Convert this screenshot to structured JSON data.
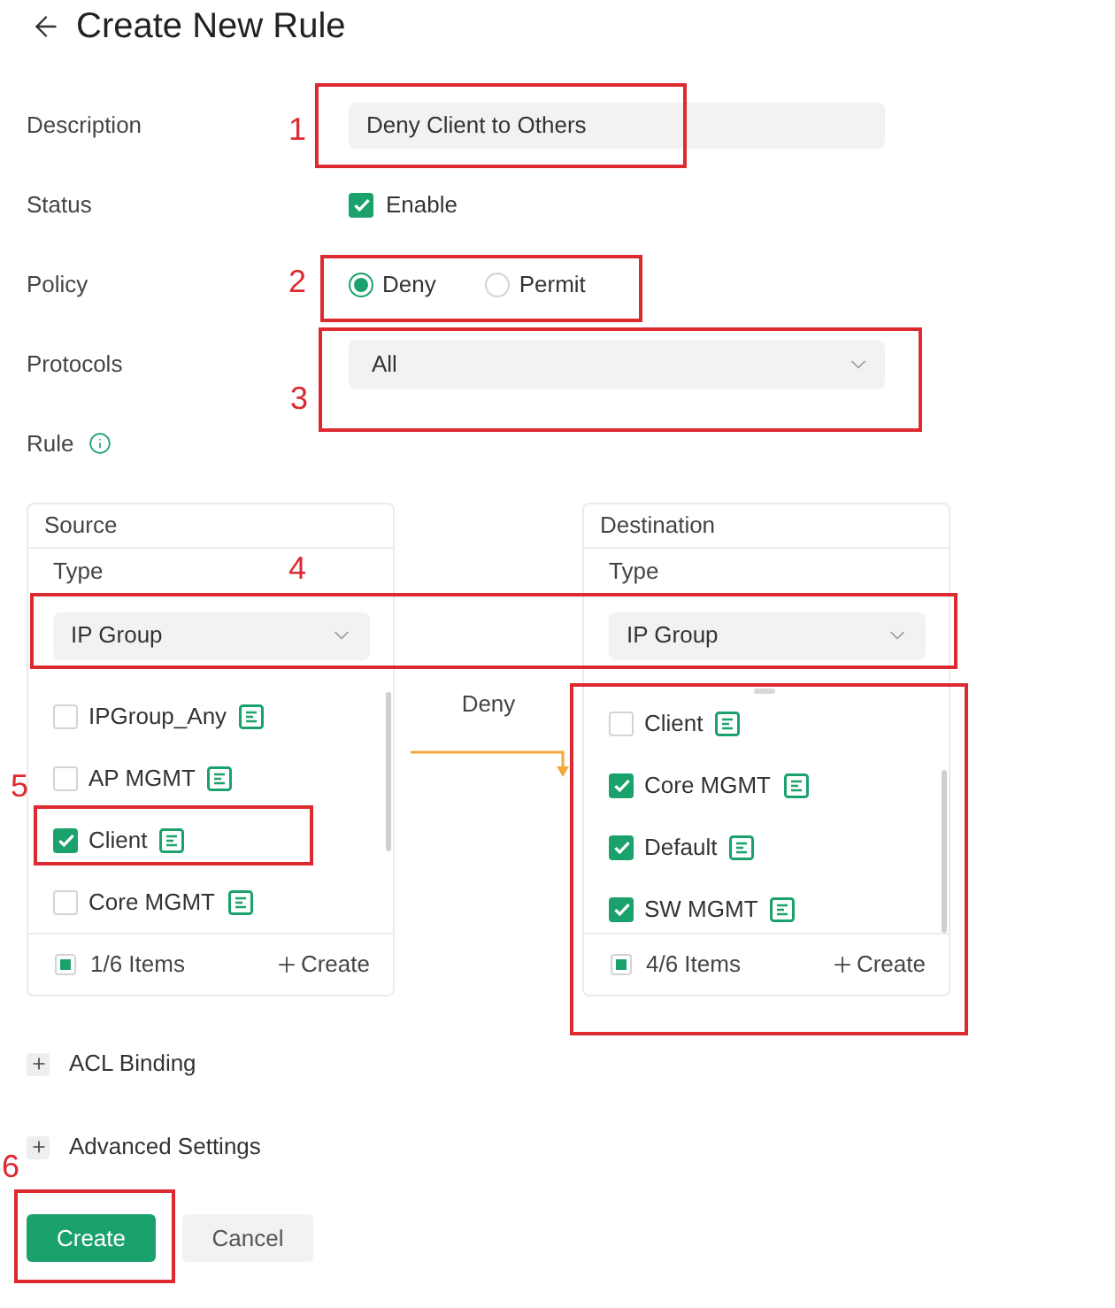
{
  "header": {
    "title": "Create New Rule"
  },
  "fields": {
    "description": {
      "label": "Description",
      "value": "Deny Client to Others"
    },
    "status": {
      "label": "Status",
      "option": "Enable",
      "checked": true
    },
    "policy": {
      "label": "Policy",
      "options": [
        {
          "label": "Deny",
          "selected": true
        },
        {
          "label": "Permit",
          "selected": false
        }
      ]
    },
    "protocols": {
      "label": "Protocols",
      "value": "All"
    },
    "rule": {
      "label": "Rule"
    }
  },
  "rule_panels": [
    {
      "title": "Source",
      "type_label": "Type",
      "type_value": "IP Group",
      "items": [
        {
          "label": "IPGroup_Any",
          "checked": false
        },
        {
          "label": "AP MGMT",
          "checked": false
        },
        {
          "label": "Client",
          "checked": true
        },
        {
          "label": "Core MGMT",
          "checked": false
        }
      ],
      "select_all": {
        "checked": false,
        "indeterminate": true
      },
      "count": "1/6 Items",
      "create": "Create"
    },
    {
      "title": "Destination",
      "type_label": "Type",
      "type_value": "IP Group",
      "items": [
        {
          "label": "Client",
          "checked": false
        },
        {
          "label": "Core MGMT",
          "checked": true
        },
        {
          "label": "Default",
          "checked": true
        },
        {
          "label": "SW MGMT",
          "checked": true
        }
      ],
      "select_all": {
        "checked": false,
        "indeterminate": true
      },
      "count": "4/6 Items",
      "create": "Create"
    }
  ],
  "connector": {
    "label": "Deny"
  },
  "sections": [
    {
      "label": "ACL Binding",
      "expanded": false
    },
    {
      "label": "Advanced Settings",
      "expanded": false
    }
  ],
  "buttons": [
    {
      "label": "Create",
      "kind": "primary"
    },
    {
      "label": "Cancel",
      "kind": "secondary"
    }
  ],
  "annotations": [
    {
      "kind": "numbered",
      "number": "1"
    },
    {
      "kind": "numbered",
      "number": "2"
    },
    {
      "kind": "numbered",
      "number": "3"
    },
    {
      "kind": "numbered",
      "number": "4"
    },
    {
      "kind": "numbered",
      "number": "5"
    },
    {
      "kind": "frame"
    },
    {
      "kind": "numbered",
      "number": "6"
    }
  ]
}
